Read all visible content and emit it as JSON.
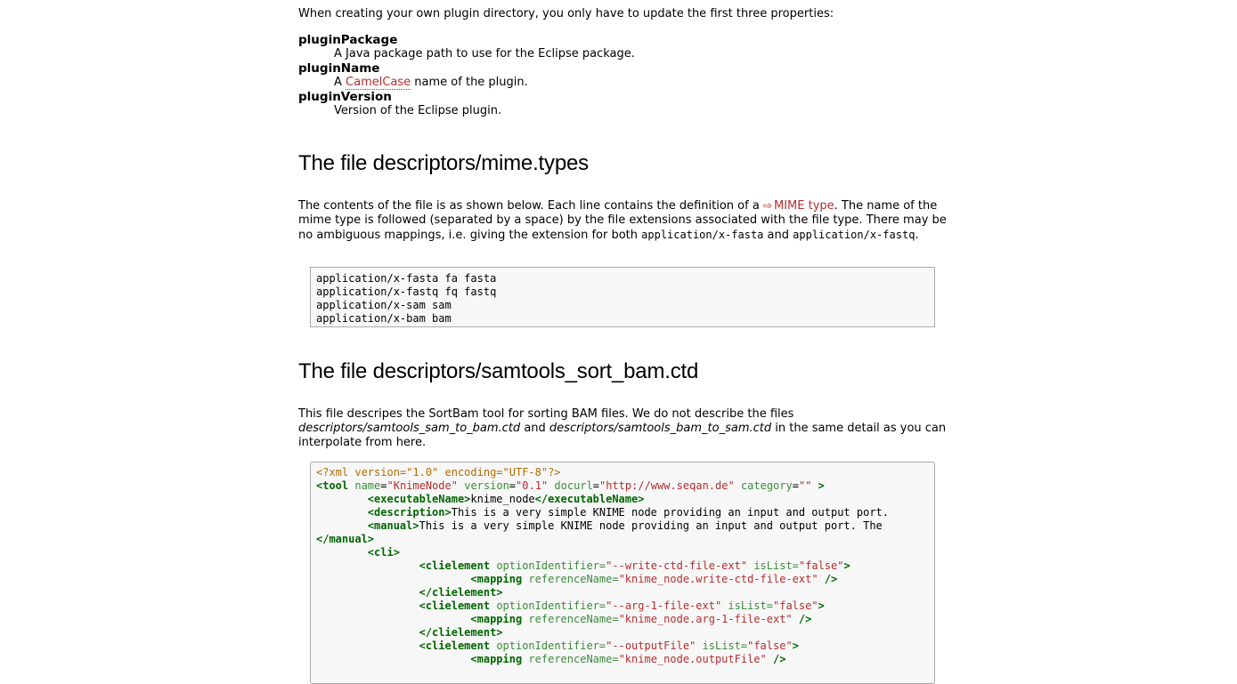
{
  "intro": "When creating your own plugin directory, you only have to update the first three properties:",
  "properties": [
    {
      "term": "pluginPackage",
      "desc_parts": [
        "A Java package path to use for the Eclipse package."
      ]
    },
    {
      "term": "pluginName",
      "desc_before": "A ",
      "desc_link": "CamelCase",
      "desc_after": " name of the plugin."
    },
    {
      "term": "pluginVersion",
      "desc_parts": [
        "Version of the Eclipse plugin."
      ]
    }
  ],
  "mime_section": {
    "heading": "The file descriptors/mime.types",
    "desc_1": "The contents of the file is as shown below. Each line contains the definition of a ",
    "link_icon": "⇨",
    "link": "MIME type",
    "desc_2": ". The name of the mime type is followed (separated by a space) by the file extensions associated with the file type. There may be no ambiguous mappings, i.e. giving the extension for both ",
    "code_1": "application/x-fasta",
    "desc_3": " and ",
    "code_2": "application/x-fastq",
    "desc_4": ".",
    "lines": [
      "application/x-fasta fa fasta",
      "application/x-fastq fq fastq",
      "application/x-sam sam",
      "application/x-bam bam"
    ]
  },
  "ctd_section": {
    "heading": "The file descriptors/samtools_sort_bam.ctd",
    "desc_1": "This file descripes the SortBam tool for sorting BAM files. We do not describe the files ",
    "em_1": "descriptors/samtools_sam_to_bam.ctd",
    "desc_2": " and ",
    "em_2": "descriptors/samtools_bam_to_sam.ctd",
    "desc_3": " in the same detail as you can interpolate from here.",
    "xml": {
      "pi": "<?xml version=\"1.0\" encoding=\"UTF-8\"?>",
      "tool_open": "<tool",
      "tool_attrs": [
        {
          "name": "name",
          "value": "\"KnimeNode\""
        },
        {
          "name": "version",
          "value": "\"0.1\""
        },
        {
          "name": "docurl",
          "value": "\"http://www.seqan.de\""
        },
        {
          "name": "category",
          "value": "\"\""
        }
      ],
      "tool_close": ">",
      "exec_open": "<executableName>",
      "exec_text": "knime_node",
      "exec_close": "</executableName>",
      "desc_open": "<description>",
      "desc_text": "This is a very simple KNIME node providing an input and output port.",
      "manual_open": "<manual>",
      "manual_text": "This is a very simple KNIME node providing an input and output port. The",
      "manual_close": "</manual>",
      "cli_open": "<cli>",
      "clielement_open": "<clielement",
      "clielement_close": "</clielement>",
      "mapping_open": "<mapping",
      "attr_option": "optionIdentifier=",
      "attr_islist": "isList=",
      "attr_ref": "referenceName=",
      "self_close": "/>",
      "gt": ">",
      "false_val": "\"false\"",
      "elements": [
        {
          "option": "\"--write-ctd-file-ext\"",
          "ref": "\"knime_node.write-ctd-file-ext\""
        },
        {
          "option": "\"--arg-1-file-ext\"",
          "ref": "\"knime_node.arg-1-file-ext\""
        },
        {
          "option": "\"--outputFile\"",
          "ref": "\"knime_node.outputFile\""
        }
      ]
    }
  },
  "colors": {
    "link": "#b32e2e",
    "tag": "#006600",
    "attr": "#3d8c3d",
    "value": "#b32e2e",
    "pi": "#b26c00"
  }
}
